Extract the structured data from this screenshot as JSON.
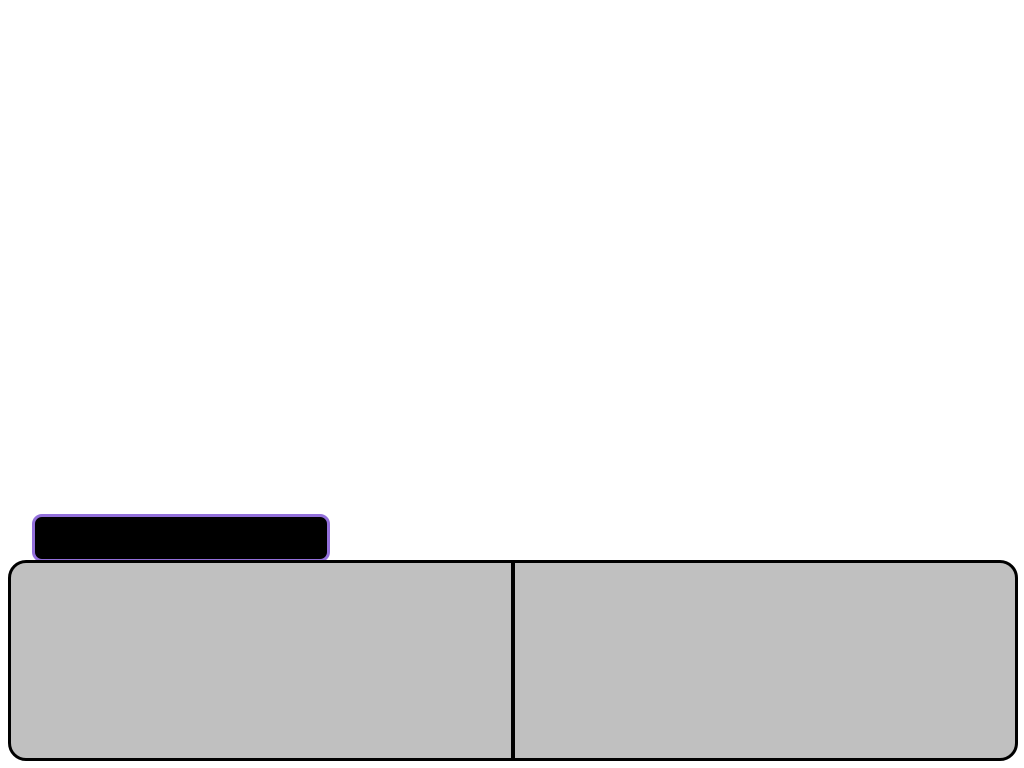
{
  "speaker": {
    "name": ""
  },
  "dialogue": {
    "left_text": "",
    "right_text": ""
  },
  "colors": {
    "background": "#ffffff",
    "name_box_fill": "#000000",
    "name_box_border": "#9370db",
    "panel_fill": "#c0c0c0",
    "panel_border": "#000000"
  }
}
